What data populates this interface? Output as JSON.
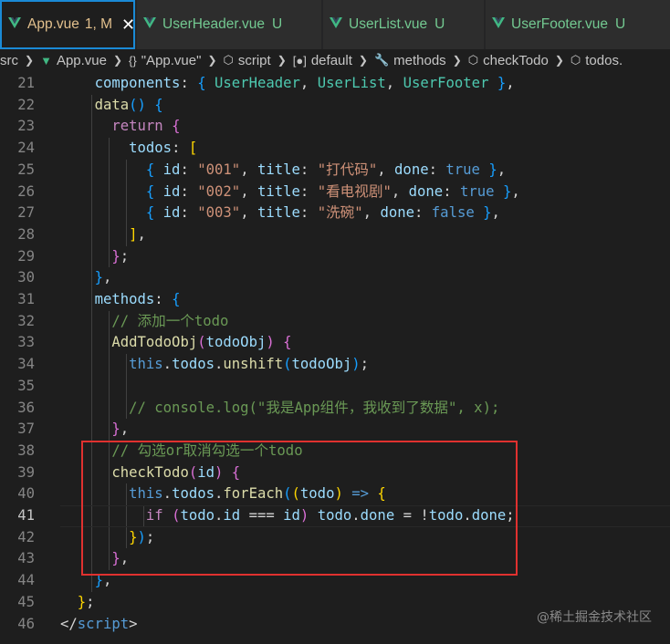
{
  "tabs": [
    {
      "name": "App.vue",
      "meta": "1, M",
      "state": "modified",
      "active": true
    },
    {
      "name": "UserHeader.vue",
      "meta": "U",
      "state": "untracked",
      "active": false
    },
    {
      "name": "UserList.vue",
      "meta": "U",
      "state": "untracked",
      "active": false
    },
    {
      "name": "UserFooter.vue",
      "meta": "U",
      "state": "untracked",
      "active": false
    }
  ],
  "close_glyph": "✕",
  "breadcrumb": {
    "items": [
      "src",
      "App.vue",
      "\"App.vue\"",
      "script",
      "default",
      "methods",
      "checkTodo",
      "todos."
    ],
    "icons": [
      "",
      "vue-icon",
      "braces-icon",
      "cube-icon",
      "bracket-icon",
      "wrench-icon",
      "cube-icon",
      "cube-icon"
    ]
  },
  "editor": {
    "current_line": 41,
    "line_numbers": [
      "21",
      "22",
      "23",
      "24",
      "25",
      "26",
      "27",
      "28",
      "29",
      "30",
      "31",
      "32",
      "33",
      "34",
      "35",
      "36",
      "37",
      "38",
      "39",
      "40",
      "41",
      "42",
      "43",
      "44",
      "45",
      "46"
    ],
    "lines": [
      [
        [
          "    ",
          "p"
        ],
        [
          "components",
          "v"
        ],
        [
          ": ",
          "p"
        ],
        [
          "{",
          "b3"
        ],
        [
          " UserHeader",
          "t"
        ],
        [
          ", ",
          "p"
        ],
        [
          "UserList",
          "t"
        ],
        [
          ", ",
          "p"
        ],
        [
          "UserFooter",
          "t"
        ],
        [
          " ",
          "p"
        ],
        [
          "}",
          "b3"
        ],
        [
          ",",
          "p"
        ]
      ],
      [
        [
          "    ",
          "p"
        ],
        [
          "data",
          "f"
        ],
        [
          "() ",
          "b3"
        ],
        [
          "{",
          "b3"
        ]
      ],
      [
        [
          "      ",
          "p"
        ],
        [
          "return",
          "c"
        ],
        [
          " ",
          "p"
        ],
        [
          "{",
          "b2"
        ]
      ],
      [
        [
          "        ",
          "p"
        ],
        [
          "todos",
          "v"
        ],
        [
          ": ",
          "p"
        ],
        [
          "[",
          "b1"
        ]
      ],
      [
        [
          "          ",
          "p"
        ],
        [
          "{",
          "b3"
        ],
        [
          " id",
          "v"
        ],
        [
          ": ",
          "p"
        ],
        [
          "\"001\"",
          "s"
        ],
        [
          ", ",
          "p"
        ],
        [
          "title",
          "v"
        ],
        [
          ": ",
          "p"
        ],
        [
          "\"打代码\"",
          "s"
        ],
        [
          ", ",
          "p"
        ],
        [
          "done",
          "v"
        ],
        [
          ": ",
          "p"
        ],
        [
          "true",
          "k"
        ],
        [
          " ",
          "p"
        ],
        [
          "}",
          "b3"
        ],
        [
          ",",
          "p"
        ]
      ],
      [
        [
          "          ",
          "p"
        ],
        [
          "{",
          "b3"
        ],
        [
          " id",
          "v"
        ],
        [
          ": ",
          "p"
        ],
        [
          "\"002\"",
          "s"
        ],
        [
          ", ",
          "p"
        ],
        [
          "title",
          "v"
        ],
        [
          ": ",
          "p"
        ],
        [
          "\"看电视剧\"",
          "s"
        ],
        [
          ", ",
          "p"
        ],
        [
          "done",
          "v"
        ],
        [
          ": ",
          "p"
        ],
        [
          "true",
          "k"
        ],
        [
          " ",
          "p"
        ],
        [
          "}",
          "b3"
        ],
        [
          ",",
          "p"
        ]
      ],
      [
        [
          "          ",
          "p"
        ],
        [
          "{",
          "b3"
        ],
        [
          " id",
          "v"
        ],
        [
          ": ",
          "p"
        ],
        [
          "\"003\"",
          "s"
        ],
        [
          ", ",
          "p"
        ],
        [
          "title",
          "v"
        ],
        [
          ": ",
          "p"
        ],
        [
          "\"洗碗\"",
          "s"
        ],
        [
          ", ",
          "p"
        ],
        [
          "done",
          "v"
        ],
        [
          ": ",
          "p"
        ],
        [
          "false",
          "k"
        ],
        [
          " ",
          "p"
        ],
        [
          "}",
          "b3"
        ],
        [
          ",",
          "p"
        ]
      ],
      [
        [
          "        ",
          "p"
        ],
        [
          "]",
          "b1"
        ],
        [
          ",",
          "p"
        ]
      ],
      [
        [
          "      ",
          "p"
        ],
        [
          "}",
          "b2"
        ],
        [
          ";",
          "p"
        ]
      ],
      [
        [
          "    ",
          "p"
        ],
        [
          "}",
          "b3"
        ],
        [
          ",",
          "p"
        ]
      ],
      [
        [
          "    ",
          "p"
        ],
        [
          "methods",
          "v"
        ],
        [
          ": ",
          "p"
        ],
        [
          "{",
          "b3"
        ]
      ],
      [
        [
          "      ",
          "p"
        ],
        [
          "// 添加一个todo",
          "cm"
        ]
      ],
      [
        [
          "      ",
          "p"
        ],
        [
          "AddTodoObj",
          "f"
        ],
        [
          "(",
          "b2"
        ],
        [
          "todoObj",
          "v"
        ],
        [
          ")",
          "b2"
        ],
        [
          " ",
          "p"
        ],
        [
          "{",
          "b2"
        ]
      ],
      [
        [
          "        ",
          "p"
        ],
        [
          "this",
          "k"
        ],
        [
          ".",
          "p"
        ],
        [
          "todos",
          "v"
        ],
        [
          ".",
          "p"
        ],
        [
          "unshift",
          "f"
        ],
        [
          "(",
          "b3"
        ],
        [
          "todoObj",
          "v"
        ],
        [
          ")",
          "b3"
        ],
        [
          ";",
          "p"
        ]
      ],
      [
        [
          "",
          "p"
        ]
      ],
      [
        [
          "        ",
          "p"
        ],
        [
          "// console.log(\"我是App组件，我收到了数据\", x);",
          "cm"
        ]
      ],
      [
        [
          "      ",
          "p"
        ],
        [
          "}",
          "b2"
        ],
        [
          ",",
          "p"
        ]
      ],
      [
        [
          "      ",
          "p"
        ],
        [
          "// 勾选or取消勾选一个todo",
          "cm"
        ]
      ],
      [
        [
          "      ",
          "p"
        ],
        [
          "checkTodo",
          "f"
        ],
        [
          "(",
          "b2"
        ],
        [
          "id",
          "v"
        ],
        [
          ")",
          "b2"
        ],
        [
          " ",
          "p"
        ],
        [
          "{",
          "b2"
        ]
      ],
      [
        [
          "        ",
          "p"
        ],
        [
          "this",
          "k"
        ],
        [
          ".",
          "p"
        ],
        [
          "todos",
          "v"
        ],
        [
          ".",
          "p"
        ],
        [
          "forEach",
          "f"
        ],
        [
          "(",
          "b3"
        ],
        [
          "(",
          "b1"
        ],
        [
          "todo",
          "v"
        ],
        [
          ")",
          "b1"
        ],
        [
          " ",
          "p"
        ],
        [
          "=>",
          "k"
        ],
        [
          " ",
          "p"
        ],
        [
          "{",
          "b1"
        ]
      ],
      [
        [
          "          ",
          "p"
        ],
        [
          "if",
          "c"
        ],
        [
          " ",
          "p"
        ],
        [
          "(",
          "b2"
        ],
        [
          "todo",
          "v"
        ],
        [
          ".",
          "p"
        ],
        [
          "id",
          "v"
        ],
        [
          " === ",
          "p"
        ],
        [
          "id",
          "v"
        ],
        [
          ")",
          "b2"
        ],
        [
          " ",
          "p"
        ],
        [
          "todo",
          "v"
        ],
        [
          ".",
          "p"
        ],
        [
          "done",
          "v"
        ],
        [
          " = !",
          "p"
        ],
        [
          "todo",
          "v"
        ],
        [
          ".",
          "p"
        ],
        [
          "done",
          "v"
        ],
        [
          ";",
          "p"
        ]
      ],
      [
        [
          "        ",
          "p"
        ],
        [
          "}",
          "b1"
        ],
        [
          ")",
          "b3"
        ],
        [
          ";",
          "p"
        ]
      ],
      [
        [
          "      ",
          "p"
        ],
        [
          "}",
          "b2"
        ],
        [
          ",",
          "p"
        ]
      ],
      [
        [
          "    ",
          "p"
        ],
        [
          "}",
          "b3"
        ],
        [
          ",",
          "p"
        ]
      ],
      [
        [
          "  ",
          "p"
        ],
        [
          "}",
          "b1"
        ],
        [
          ";",
          "p"
        ]
      ],
      [
        [
          "",
          "p"
        ],
        [
          "</",
          "p"
        ],
        [
          "script",
          "k"
        ],
        [
          ">",
          "p"
        ]
      ]
    ]
  },
  "watermark": "@稀土掘金技术社区"
}
